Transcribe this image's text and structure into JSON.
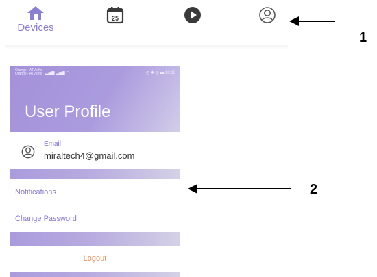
{
  "nav": {
    "items": [
      {
        "label": "Devices",
        "icon": "home-icon",
        "active": true
      },
      {
        "label": "",
        "icon": "calendar-icon",
        "calendar_day": "25"
      },
      {
        "label": "",
        "icon": "play-icon"
      },
      {
        "label": "",
        "icon": "user-profile-icon"
      }
    ],
    "active_color": "#8b7fd0"
  },
  "annotations": {
    "callout_1": "1",
    "callout_2": "2"
  },
  "status_bar": {
    "carrier_line1": "Orange - ATVs fix",
    "carrier_line2": "Orange - ATVs fix",
    "time": "10:38"
  },
  "profile": {
    "title": "User Profile",
    "email_label": "Email",
    "email_value": "miraltech4@gmail.com",
    "items": [
      "Notifications",
      "Change Password"
    ],
    "logout": "Logout"
  },
  "colors": {
    "header_purple": "#a491da",
    "accent_purple": "#7e72c6",
    "logout_orange": "#e98f5a"
  }
}
